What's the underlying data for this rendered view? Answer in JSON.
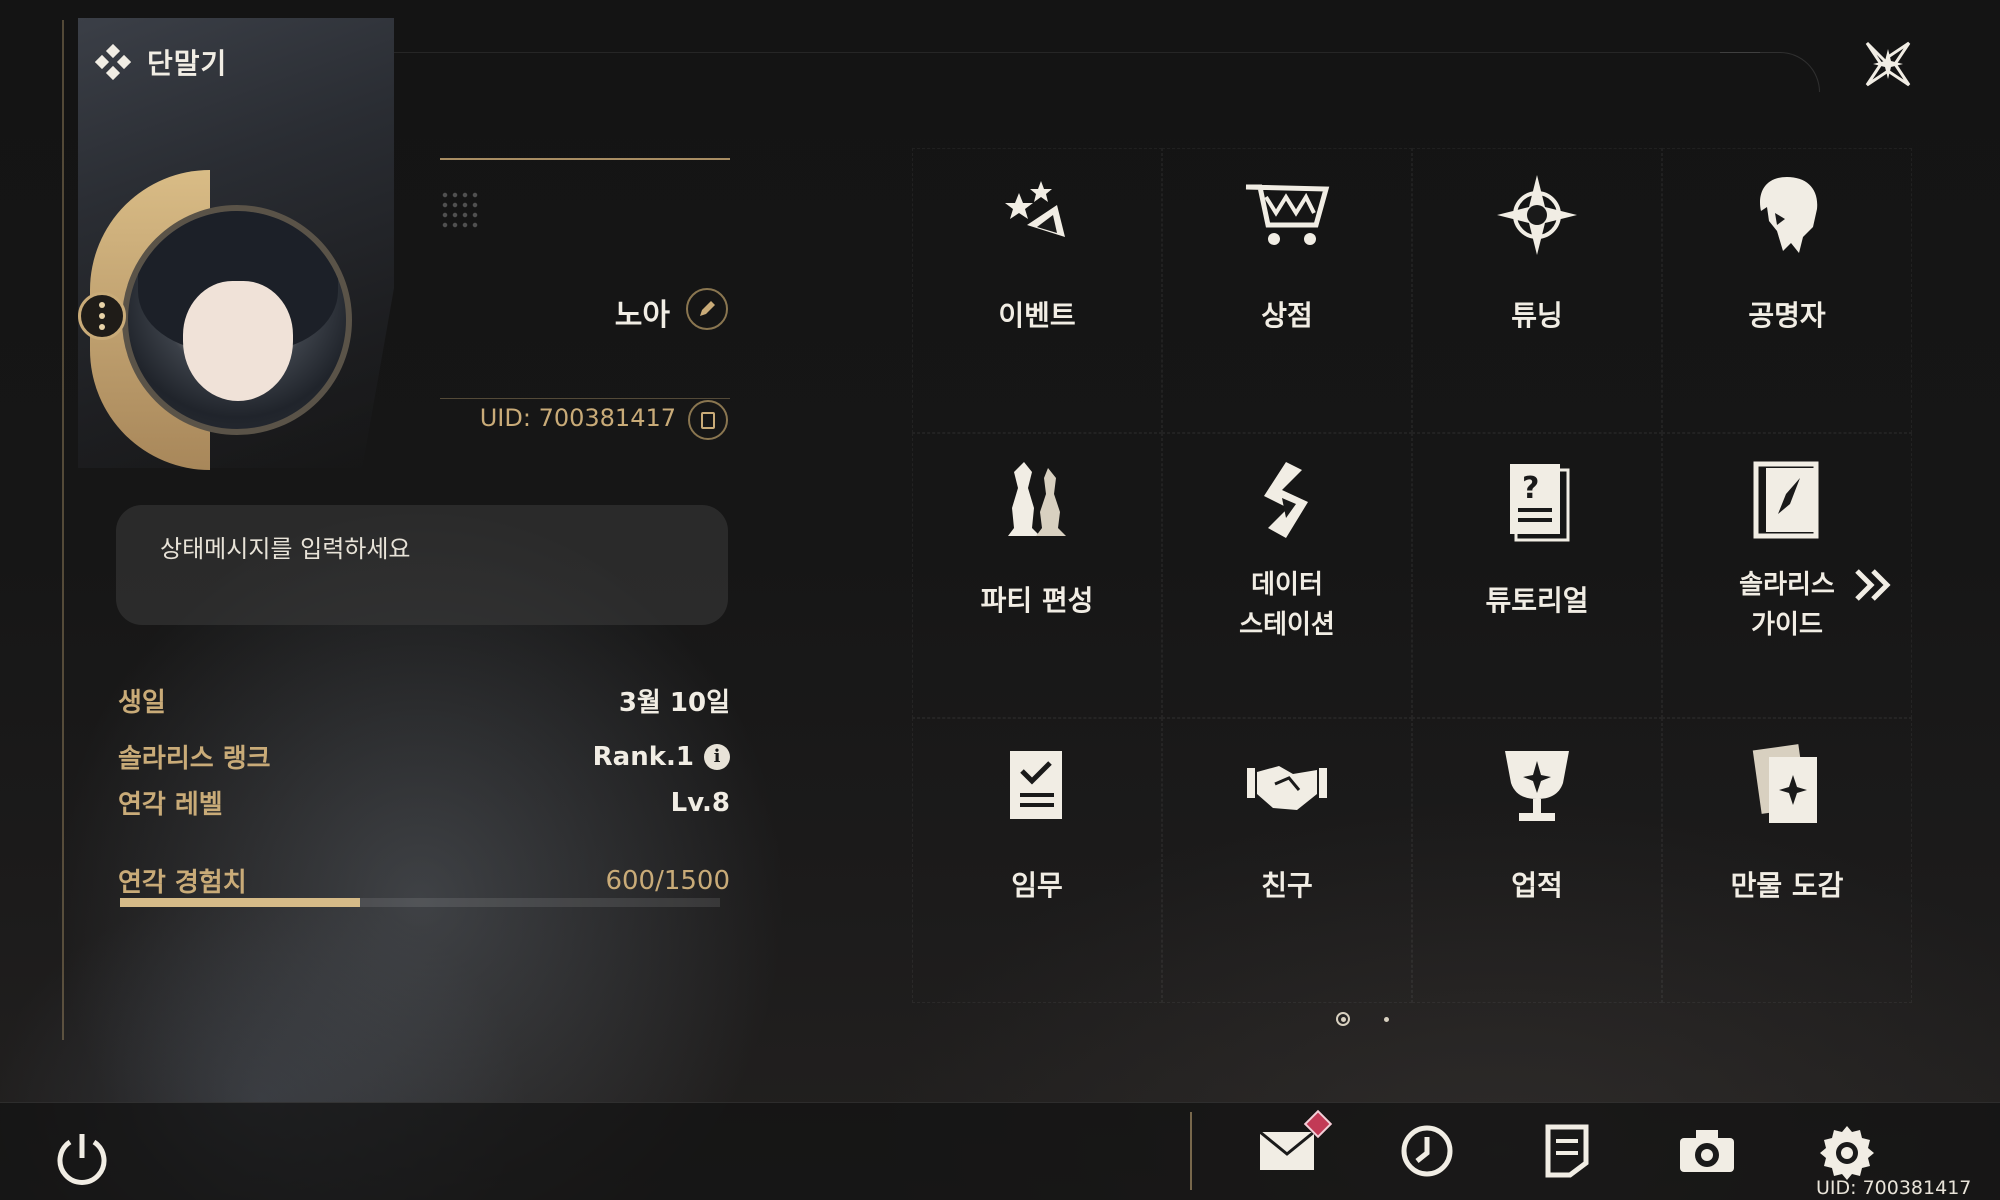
{
  "header": {
    "title": "단말기",
    "close_icon": "close-icon"
  },
  "profile": {
    "name": "노아",
    "uid": "UID: 700381417",
    "status_placeholder": "상태메시지를 입력하세요",
    "stats": [
      {
        "label": "생일",
        "value": "3월 10일"
      },
      {
        "label": "솔라리스 랭크",
        "value": "Rank.1"
      },
      {
        "label": "연각 레벨",
        "value": "Lv.8"
      }
    ],
    "exp": {
      "label": "연각 경험치",
      "value": "600/1500",
      "progress": 0.4
    }
  },
  "menu": [
    {
      "label": "이벤트",
      "icon": "event-icon"
    },
    {
      "label": "상점",
      "icon": "shop-cart-icon"
    },
    {
      "label": "튜닝",
      "icon": "tuning-star-icon"
    },
    {
      "label": "공명자",
      "icon": "resonator-icon"
    },
    {
      "label": "파티 편성",
      "icon": "party-chess-icon"
    },
    {
      "label": "데이터\n스테이션",
      "icon": "data-station-icon"
    },
    {
      "label": "튜토리얼",
      "icon": "tutorial-icon"
    },
    {
      "label": "솔라리스\n가이드",
      "icon": "guide-compass-icon"
    },
    {
      "label": "임무",
      "icon": "mission-icon"
    },
    {
      "label": "친구",
      "icon": "friends-handshake-icon"
    },
    {
      "label": "업적",
      "icon": "achievement-trophy-icon"
    },
    {
      "label": "만물 도감",
      "icon": "archive-cards-icon"
    }
  ],
  "pager": {
    "pages": 2,
    "active": 1
  },
  "bottom_bar": {
    "icons": [
      "power-icon",
      "mail-icon",
      "clock-icon",
      "notes-icon",
      "camera-icon",
      "settings-icon"
    ],
    "uid": "UID: 700381417",
    "mail_badge": "!"
  },
  "colors": {
    "accent_gold": "#c9ab78",
    "badge_red": "#c23a56",
    "text": "#f1ede4"
  }
}
